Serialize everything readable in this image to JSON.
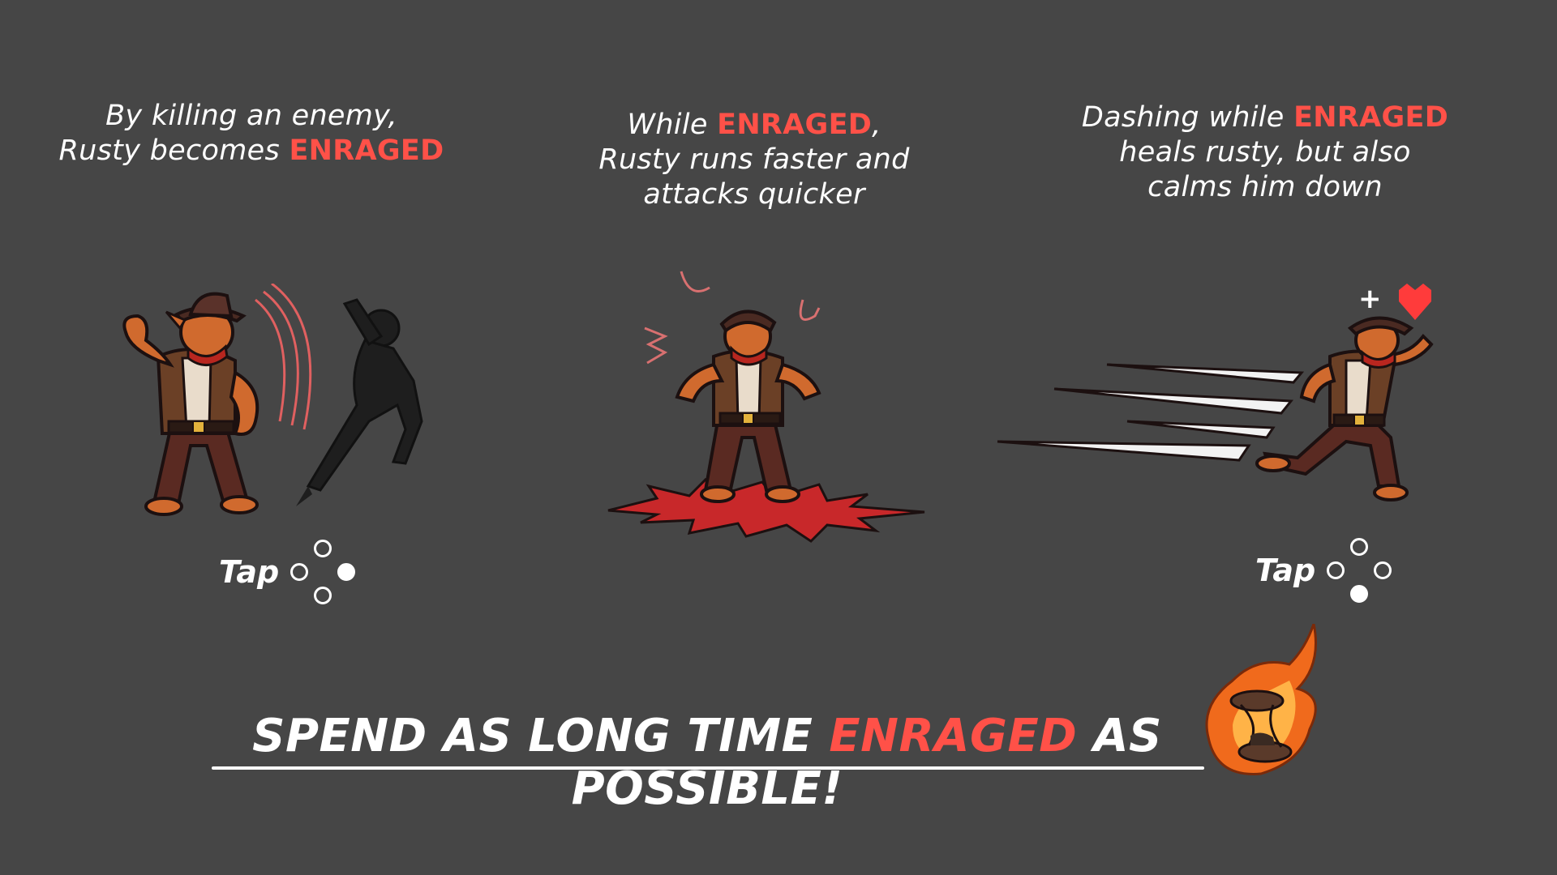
{
  "panels": [
    {
      "line1": "By killing an enemy,",
      "line2_prefix": "Rusty becomes ",
      "line2_highlight": "ENRAGED",
      "input_label": "Tap",
      "input_pressed": "right"
    },
    {
      "line1_prefix": "While ",
      "line1_highlight": "ENRAGED",
      "line1_suffix": ",",
      "line2": "Rusty runs faster and",
      "line3": "attacks quicker"
    },
    {
      "line1_prefix": "Dashing while ",
      "line1_highlight": "ENRAGED",
      "line2": "heals rusty, but also",
      "line3": "calms him down",
      "heal_sign": "+",
      "input_label": "Tap",
      "input_pressed": "bottom"
    }
  ],
  "banner": {
    "prefix": "SPEND AS LONG TIME ",
    "highlight": "ENRAGED",
    "suffix": " AS POSSIBLE!"
  },
  "colors": {
    "background": "#464646",
    "highlight": "#ff5148",
    "text": "#ffffff",
    "heart": "#ff3b3b",
    "flame": "#f06a1c"
  },
  "icons": [
    "button-cluster-icon",
    "heart-icon",
    "hourglass-flame-icon"
  ]
}
